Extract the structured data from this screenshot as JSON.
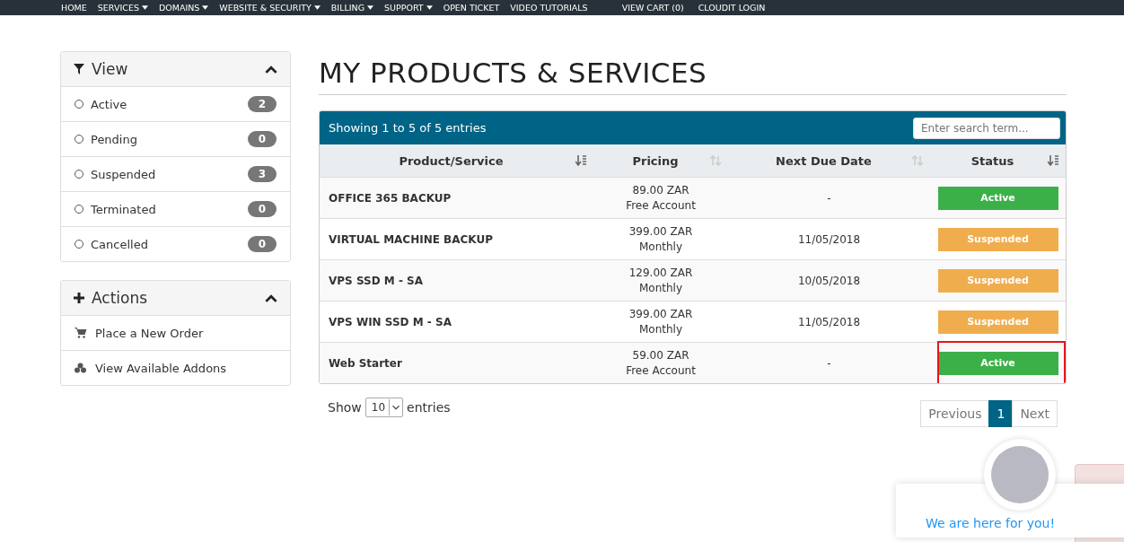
{
  "nav": {
    "items": [
      {
        "label": "HOME",
        "caret": false
      },
      {
        "label": "SERVICES",
        "caret": true
      },
      {
        "label": "DOMAINS",
        "caret": true
      },
      {
        "label": "WEBSITE & SECURITY",
        "caret": true
      },
      {
        "label": "BILLING",
        "caret": true
      },
      {
        "label": "SUPPORT",
        "caret": true
      },
      {
        "label": "OPEN TICKET",
        "caret": false
      },
      {
        "label": "VIDEO TUTORIALS",
        "caret": false
      }
    ],
    "cart": "VIEW CART (0)",
    "login": "CLOUDIT LOGIN"
  },
  "view_panel": {
    "title": "View",
    "expanded": true,
    "items": [
      {
        "label": "Active",
        "count": "2",
        "selected": false
      },
      {
        "label": "Pending",
        "count": "0",
        "selected": false
      },
      {
        "label": "Suspended",
        "count": "3",
        "selected": false
      },
      {
        "label": "Terminated",
        "count": "0",
        "selected": false
      },
      {
        "label": "Cancelled",
        "count": "0",
        "selected": false
      }
    ]
  },
  "actions_panel": {
    "title": "Actions",
    "expanded": true,
    "items": [
      {
        "label": "Place a New Order",
        "kind": "cart"
      },
      {
        "label": "View Available Addons",
        "kind": "addons"
      }
    ]
  },
  "page_title": "MY PRODUCTS & SERVICES",
  "table": {
    "info": "Showing 1 to 5 of 5 entries",
    "search": {
      "placeholder": "Enter search term..."
    },
    "columns": [
      {
        "label": "Product/Service",
        "sorted": true
      },
      {
        "label": "Pricing",
        "sorted": false
      },
      {
        "label": "Next Due Date",
        "sorted": false
      },
      {
        "label": "Status",
        "sorted": true
      }
    ],
    "rows": [
      {
        "product": "OFFICE 365 BACKUP",
        "price": "89.00 ZAR",
        "cycle": "Free Account",
        "due": "-",
        "status": "Active",
        "kind": "active",
        "highlighted": false
      },
      {
        "product": "VIRTUAL MACHINE BACKUP",
        "price": "399.00 ZAR",
        "cycle": "Monthly",
        "due": "11/05/2018",
        "status": "Suspended",
        "kind": "suspended",
        "highlighted": false
      },
      {
        "product": "VPS SSD M - SA",
        "price": "129.00 ZAR",
        "cycle": "Monthly",
        "due": "10/05/2018",
        "status": "Suspended",
        "kind": "suspended",
        "highlighted": false
      },
      {
        "product": "VPS WIN SSD M - SA",
        "price": "399.00 ZAR",
        "cycle": "Monthly",
        "due": "11/05/2018",
        "status": "Suspended",
        "kind": "suspended",
        "highlighted": false
      },
      {
        "product": "Web Starter",
        "price": "59.00 ZAR",
        "cycle": "Free Account",
        "due": "-",
        "status": "Active",
        "kind": "active",
        "highlighted": true
      }
    ],
    "show_label": "Show",
    "page_size": "10",
    "entries_label": "entries",
    "pagination": [
      {
        "label": "Previous",
        "selected": false
      },
      {
        "label": "1",
        "selected": true
      },
      {
        "label": "Next",
        "selected": false
      }
    ]
  },
  "chat": {
    "message": "We are here for you!"
  }
}
